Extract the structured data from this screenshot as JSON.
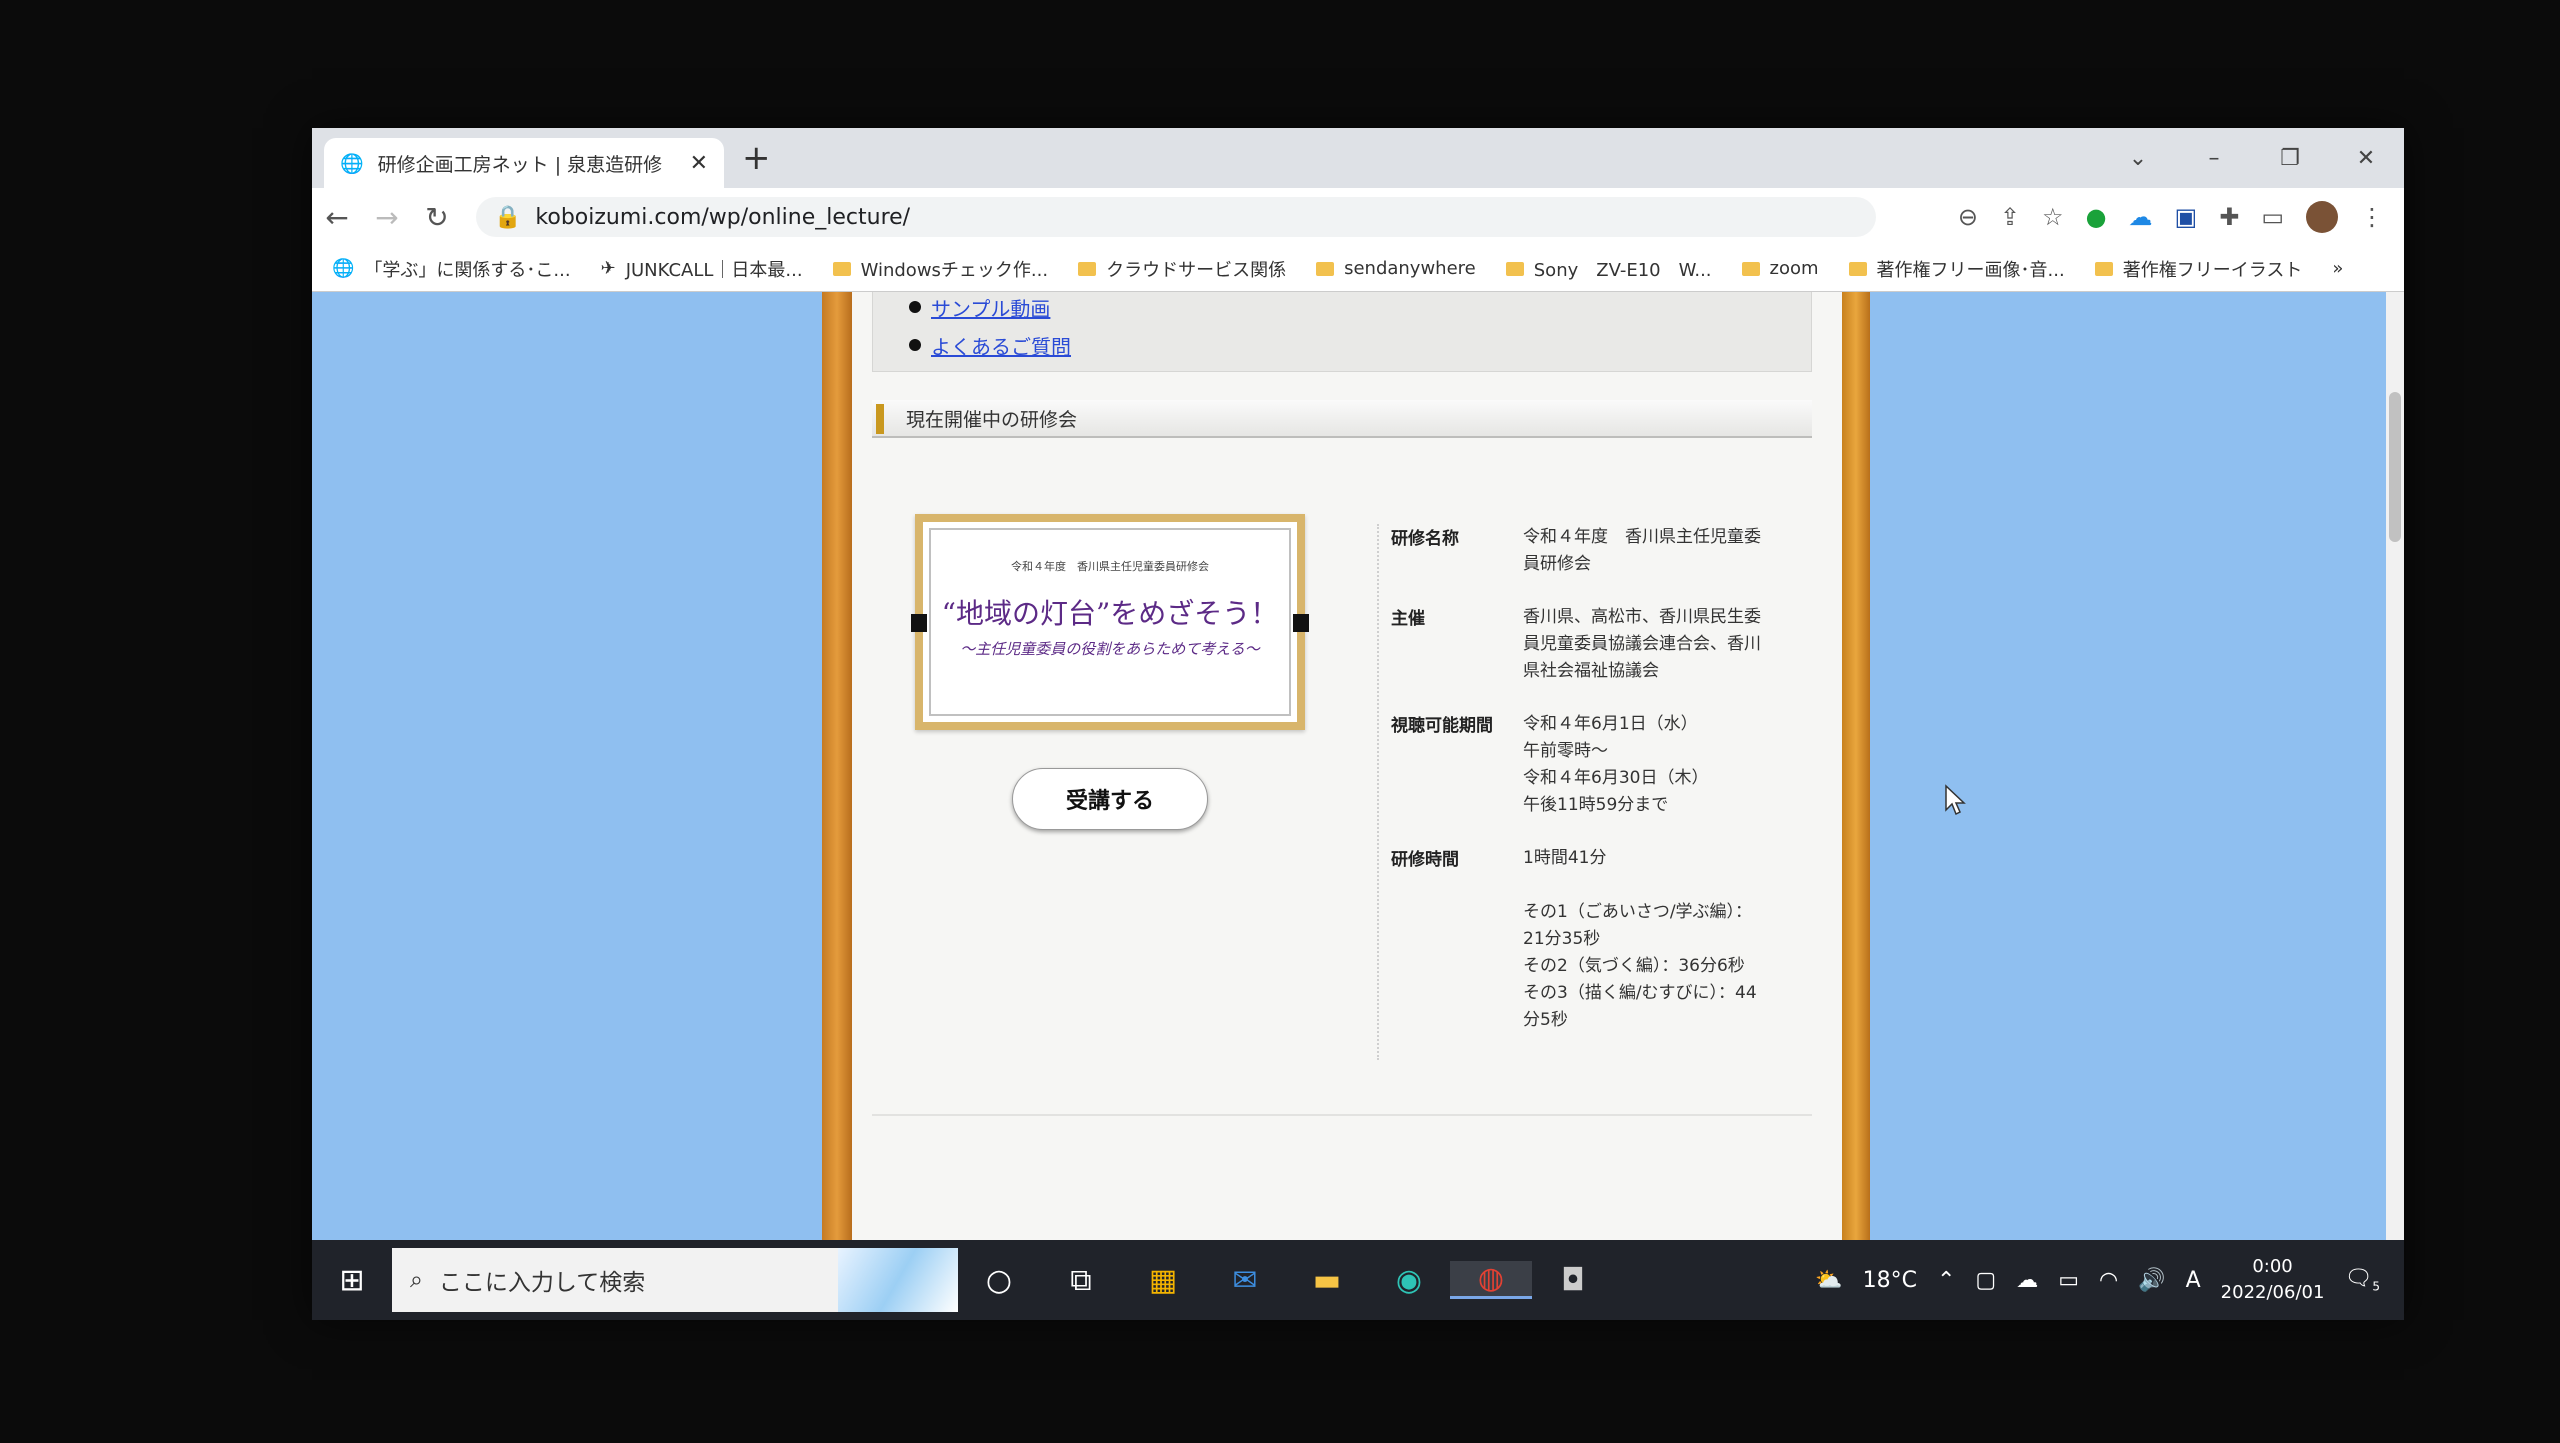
{
  "browser": {
    "tab_title": "研修企画工房ネット | 泉恵造研修",
    "url": "koboizumi.com/wp/online_lecture/",
    "bookmarks": [
      "「学ぶ」に関係する･こ...",
      "JUNKCALL｜日本最...",
      "Windowsチェック作...",
      "クラウドサービス関係",
      "sendanywhere",
      "Sony　ZV-E10　W...",
      "zoom",
      "著作権フリー画像･音...",
      "著作権フリーイラスト"
    ]
  },
  "page": {
    "menu_links": [
      "サンプル動画",
      "よくあるご質問"
    ],
    "section_title": "現在開催中の研修会",
    "banner": {
      "small": "令和４年度　香川県主任児童委員研修会",
      "title": "“地域の灯台”をめざそう！",
      "subtitle": "～主任児童委員の役割をあらためて考える～"
    },
    "enroll_button": "受講する",
    "info": {
      "name_label": "研修名称",
      "name_lines": [
        "令和４年度　香川県主任児童委",
        "員研修会"
      ],
      "host_label": "主催",
      "host_lines": [
        "香川県、高松市、香川県民生委",
        "員児童委員協議会連合会、香川",
        "県社会福祉協議会"
      ],
      "period_label": "視聴可能期間",
      "period_lines": [
        "令和４年6月1日（水）",
        "午前零時～",
        "令和４年6月30日（木）",
        "午後11時59分まで"
      ],
      "time_label": "研修時間",
      "time_lines": [
        "1時間41分",
        " ",
        "その1（ごあいさつ/学ぶ編）：",
        "21分35秒",
        "その2（気づく編）：36分6秒",
        "その3（描く編/むすびに）：44",
        "分5秒"
      ]
    }
  },
  "taskbar": {
    "search_placeholder": "ここに入力して検索",
    "temperature": "18°C",
    "ime": "A",
    "time": "0:00",
    "date": "2022/06/01",
    "notifications": "5"
  }
}
